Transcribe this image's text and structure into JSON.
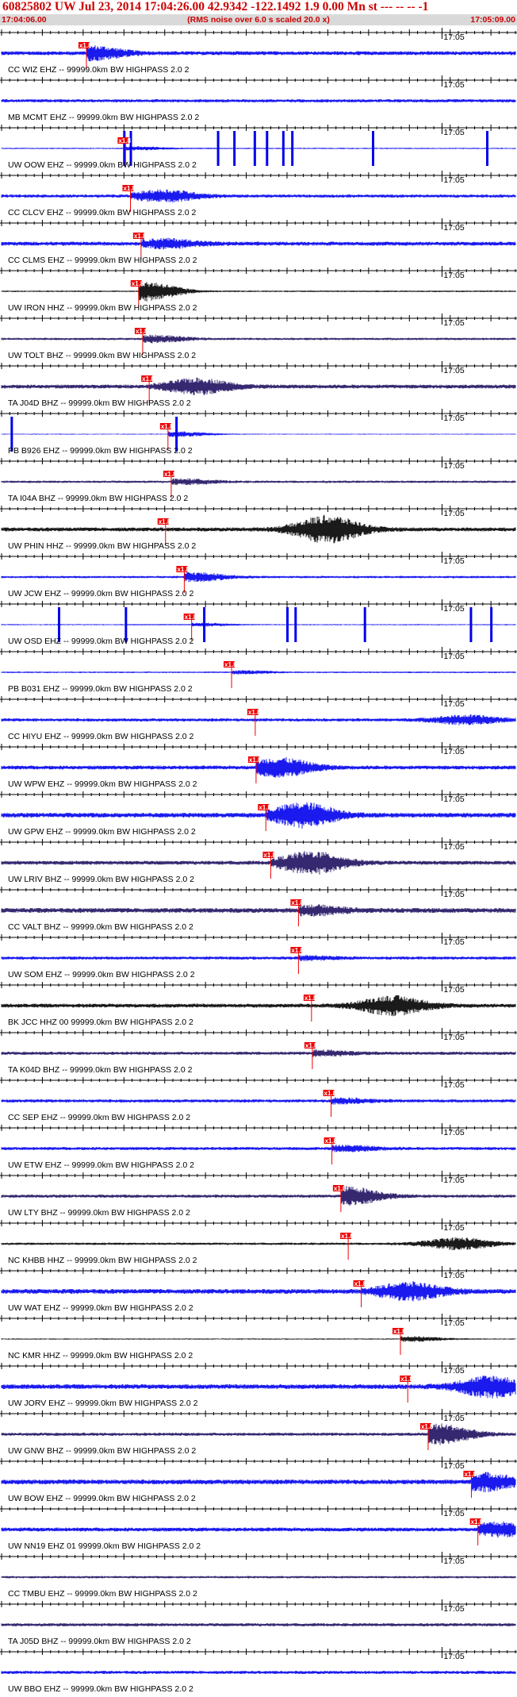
{
  "header": {
    "title": "60825802 UW Jul 23, 2014 17:04:26.00   42.9342 -122.1492  1.9 0.00 Mn st --- -- --  -1",
    "start_time": "17:04:06.00",
    "rms_note": "(RMS noise over 6.0 s scaled 20.0 x)",
    "end_time": "17:05:09.00"
  },
  "colors": {
    "blue": "#0000ee",
    "navy": "#201060",
    "black": "#000000",
    "pick": "#ee0000"
  },
  "chart_data": {
    "type": "seismogram",
    "x_range_seconds": [
      0,
      63
    ],
    "minute_mark_label": "17:05",
    "minute_mark_offset_s": 54,
    "pick_label": "x1.8",
    "filter_suffix": "- 99999.0km BW  HIGHPASS  2.0  2",
    "stations": [
      {
        "label": "CC WIZ EHZ -- 99999.0km BW  HIGHPASS  2.0  2",
        "color": "blue",
        "pick_s": 10.4,
        "amp": 0.25,
        "burst": 0.8,
        "burst_s": 10.9
      },
      {
        "label": "MB MCMT EHZ -- 99999.0km BW  HIGHPASS  2.0  2",
        "color": "blue",
        "pick_s": null,
        "amp": 0.2,
        "burst": 0.6,
        "burst_s": 14.5
      },
      {
        "label": "UW OOW EHZ -- 99999.0km BW  HIGHPASS  2.0  2",
        "color": "blue",
        "pick_s": 15.2,
        "amp": 0.08,
        "burst": 0.2,
        "burst_s": 16,
        "spikes": [
          15.0,
          15.8,
          26.5,
          28.5,
          31.0,
          32.5,
          34.5,
          35.6,
          45.5,
          59.5
        ]
      },
      {
        "label": "CC CLCV EHZ -- 99999.0km BW  HIGHPASS  2.0  2",
        "color": "blue",
        "pick_s": 15.8,
        "amp": 0.2,
        "burst": 0.7,
        "burst_s": 20
      },
      {
        "label": "CC CLMS EHZ -- 99999.0km BW  HIGHPASS  2.0  2",
        "color": "blue",
        "pick_s": 17.1,
        "amp": 0.25,
        "burst": 0.5,
        "burst_s": 20
      },
      {
        "label": "UW IRON HHZ -- 99999.0km BW  HIGHPASS  2.0  2",
        "color": "black",
        "pick_s": 16.8,
        "amp": 0.1,
        "burst": 1.2,
        "burst_s": 17.6
      },
      {
        "label": "UW TOLT BHZ -- 99999.0km BW  HIGHPASS  2.0  2",
        "color": "navy",
        "pick_s": 17.3,
        "amp": 0.15,
        "burst": 0.4,
        "burst_s": 18.5
      },
      {
        "label": "TA J04D BHZ -- 99999.0km BW  HIGHPASS  2.0  2",
        "color": "navy",
        "pick_s": 18.1,
        "amp": 0.25,
        "burst": 0.9,
        "burst_s": 24
      },
      {
        "label": "PB B926 EHZ -- 99999.0km BW  HIGHPASS  2.0  2",
        "color": "blue",
        "pick_s": 20.4,
        "amp": 0.06,
        "burst": 0.3,
        "burst_s": 21.5,
        "spikes": [
          1.2,
          21.4
        ]
      },
      {
        "label": "TA I04A BHZ -- 99999.0km BW  HIGHPASS  2.0  2",
        "color": "navy",
        "pick_s": 20.8,
        "amp": 0.15,
        "burst": 0.3,
        "burst_s": 22
      },
      {
        "label": "UW PHIN HHZ -- 99999.0km BW  HIGHPASS  2.0  2",
        "color": "black",
        "pick_s": 20.1,
        "amp": 0.25,
        "burst": 1.6,
        "burst_s": 40
      },
      {
        "label": "UW JCW EHZ -- 99999.0km BW  HIGHPASS  2.0  2",
        "color": "blue",
        "pick_s": 22.4,
        "amp": 0.15,
        "burst": 0.5,
        "burst_s": 23.5
      },
      {
        "label": "UW OSD EHZ -- 99999.0km BW  HIGHPASS  2.0  2",
        "color": "blue",
        "pick_s": 23.3,
        "amp": 0.07,
        "burst": 0.2,
        "burst_s": 24,
        "spikes": [
          7.0,
          15.2,
          24.8,
          35.0,
          36.0,
          44.5,
          57.5,
          60.0
        ]
      },
      {
        "label": "PB B031 EHZ -- 99999.0km BW  HIGHPASS  2.0  2",
        "color": "blue",
        "pick_s": 28.2,
        "amp": 0.1,
        "burst": 0.2,
        "burst_s": 29
      },
      {
        "label": "CC HIYU EHZ -- 99999.0km BW  HIGHPASS  2.0  2",
        "color": "blue",
        "pick_s": 31.1,
        "amp": 0.2,
        "burst": 0.5,
        "burst_s": 57
      },
      {
        "label": "UW WPW EHZ -- 99999.0km BW  HIGHPASS  2.0  2",
        "color": "blue",
        "pick_s": 31.2,
        "amp": 0.25,
        "burst": 1.1,
        "burst_s": 34
      },
      {
        "label": "UW GPW EHZ -- 99999.0km BW  HIGHPASS  2.0  2",
        "color": "blue",
        "pick_s": 32.4,
        "amp": 0.3,
        "burst": 1.4,
        "burst_s": 37
      },
      {
        "label": "UW LRIV BHZ -- 99999.0km BW  HIGHPASS  2.0  2",
        "color": "navy",
        "pick_s": 33.0,
        "amp": 0.25,
        "burst": 1.3,
        "burst_s": 38
      },
      {
        "label": "CC VALT BHZ -- 99999.0km BW  HIGHPASS  2.0  2",
        "color": "navy",
        "pick_s": 36.4,
        "amp": 0.3,
        "burst": 0.5,
        "burst_s": 38
      },
      {
        "label": "UW SOM EHZ -- 99999.0km BW  HIGHPASS  2.0  2",
        "color": "blue",
        "pick_s": 36.4,
        "amp": 0.2,
        "burst": 0.2,
        "burst_s": 37
      },
      {
        "label": "BK JCC HHZ 00 99999.0km BW  HIGHPASS  2.0  2",
        "color": "black",
        "pick_s": 38.0,
        "amp": 0.25,
        "burst": 1.1,
        "burst_s": 48
      },
      {
        "label": "TA K04D BHZ -- 99999.0km BW  HIGHPASS  2.0  2",
        "color": "navy",
        "pick_s": 38.1,
        "amp": 0.2,
        "burst": 0.3,
        "burst_s": 39
      },
      {
        "label": "CC SEP EHZ -- 99999.0km BW  HIGHPASS  2.0  2",
        "color": "blue",
        "pick_s": 40.4,
        "amp": 0.2,
        "burst": 0.3,
        "burst_s": 41
      },
      {
        "label": "UW ETW EHZ -- 99999.0km BW  HIGHPASS  2.0  2",
        "color": "blue",
        "pick_s": 40.5,
        "amp": 0.2,
        "burst": 0.3,
        "burst_s": 42
      },
      {
        "label": "UW LTY BHZ -- 99999.0km BW  HIGHPASS  2.0  2",
        "color": "navy",
        "pick_s": 41.6,
        "amp": 0.2,
        "burst": 1.1,
        "burst_s": 42.5
      },
      {
        "label": "NC KHBB HHZ -- 99999.0km BW  HIGHPASS  2.0  2",
        "color": "black",
        "pick_s": 42.5,
        "amp": 0.15,
        "burst": 0.7,
        "burst_s": 56
      },
      {
        "label": "UW WAT EHZ -- 99999.0km BW  HIGHPASS  2.0  2",
        "color": "blue",
        "pick_s": 44.1,
        "amp": 0.3,
        "burst": 1.0,
        "burst_s": 50
      },
      {
        "label": "NC KMR HHZ -- 99999.0km BW  HIGHPASS  2.0  2",
        "color": "black",
        "pick_s": 48.9,
        "amp": 0.08,
        "burst": 0.3,
        "burst_s": 50
      },
      {
        "label": "UW JORV EHZ -- 99999.0km BW  HIGHPASS  2.0  2",
        "color": "blue",
        "pick_s": 49.8,
        "amp": 0.3,
        "burst": 1.2,
        "burst_s": 60
      },
      {
        "label": "UW GNW BHZ -- 99999.0km BW  HIGHPASS  2.0  2",
        "color": "navy",
        "pick_s": 52.3,
        "amp": 0.2,
        "burst": 1.2,
        "burst_s": 53.5
      },
      {
        "label": "UW BOW EHZ -- 99999.0km BW  HIGHPASS  2.0  2",
        "color": "blue",
        "pick_s": 57.6,
        "amp": 0.3,
        "burst": 1.0,
        "burst_s": 59
      },
      {
        "label": "UW NN19 EHZ 01 99999.0km BW  HIGHPASS  2.0  2",
        "color": "blue",
        "pick_s": 58.4,
        "amp": 0.25,
        "burst": 0.8,
        "burst_s": 61
      },
      {
        "label": "CC TMBU EHZ -- 99999.0km BW  HIGHPASS  2.0  2",
        "color": "navy",
        "pick_s": null,
        "amp": 0.15,
        "burst": 0.2,
        "burst_s": 30
      },
      {
        "label": "TA J05D BHZ -- 99999.0km BW  HIGHPASS  2.0  2",
        "color": "navy",
        "pick_s": null,
        "amp": 0.2,
        "burst": 0.4,
        "burst_s": 61
      },
      {
        "label": "UW BBO EHZ -- 99999.0km BW  HIGHPASS  2.0  2",
        "color": "blue",
        "pick_s": null,
        "amp": 0.2,
        "burst": 0.2,
        "burst_s": 30
      }
    ]
  }
}
